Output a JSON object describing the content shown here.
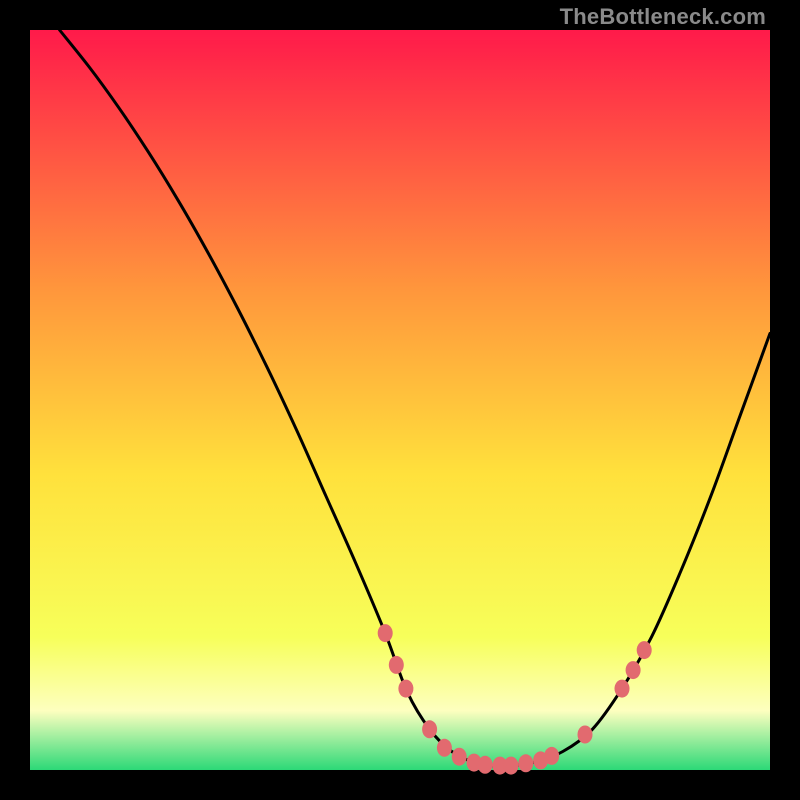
{
  "attribution": "TheBottleneck.com",
  "colors": {
    "top": "#ff1a4a",
    "mid_upper": "#ff963c",
    "mid": "#ffe13c",
    "lower": "#f7ff5a",
    "band_pale": "#fdffbf",
    "bottom": "#2cd977",
    "curve": "#000000",
    "marker": "#e26a6f"
  },
  "chart_data": {
    "type": "line",
    "title": "",
    "xlabel": "",
    "ylabel": "",
    "xlim": [
      0,
      100
    ],
    "ylim": [
      0,
      100
    ],
    "curve": {
      "x": [
        4,
        8,
        12,
        16,
        20,
        24,
        28,
        32,
        36,
        40,
        44,
        48,
        51,
        54,
        57,
        60,
        62,
        65,
        68,
        72,
        76,
        80,
        84,
        88,
        92,
        96,
        100
      ],
      "y": [
        100,
        95,
        89.5,
        83.5,
        77,
        70,
        62.5,
        54.5,
        46,
        37,
        28,
        18.5,
        10.5,
        5.5,
        2.5,
        1,
        0.6,
        0.6,
        1,
        2.5,
        5.5,
        11,
        18,
        27,
        37,
        48,
        59
      ]
    },
    "markers": [
      {
        "x": 48.0,
        "y": 18.5
      },
      {
        "x": 49.5,
        "y": 14.2
      },
      {
        "x": 50.8,
        "y": 11.0
      },
      {
        "x": 54.0,
        "y": 5.5
      },
      {
        "x": 56.0,
        "y": 3.0
      },
      {
        "x": 58.0,
        "y": 1.8
      },
      {
        "x": 60.0,
        "y": 1.0
      },
      {
        "x": 61.5,
        "y": 0.7
      },
      {
        "x": 63.5,
        "y": 0.6
      },
      {
        "x": 65.0,
        "y": 0.6
      },
      {
        "x": 67.0,
        "y": 0.9
      },
      {
        "x": 69.0,
        "y": 1.3
      },
      {
        "x": 70.5,
        "y": 1.9
      },
      {
        "x": 75.0,
        "y": 4.8
      },
      {
        "x": 80.0,
        "y": 11.0
      },
      {
        "x": 81.5,
        "y": 13.5
      },
      {
        "x": 83.0,
        "y": 16.2
      }
    ]
  }
}
